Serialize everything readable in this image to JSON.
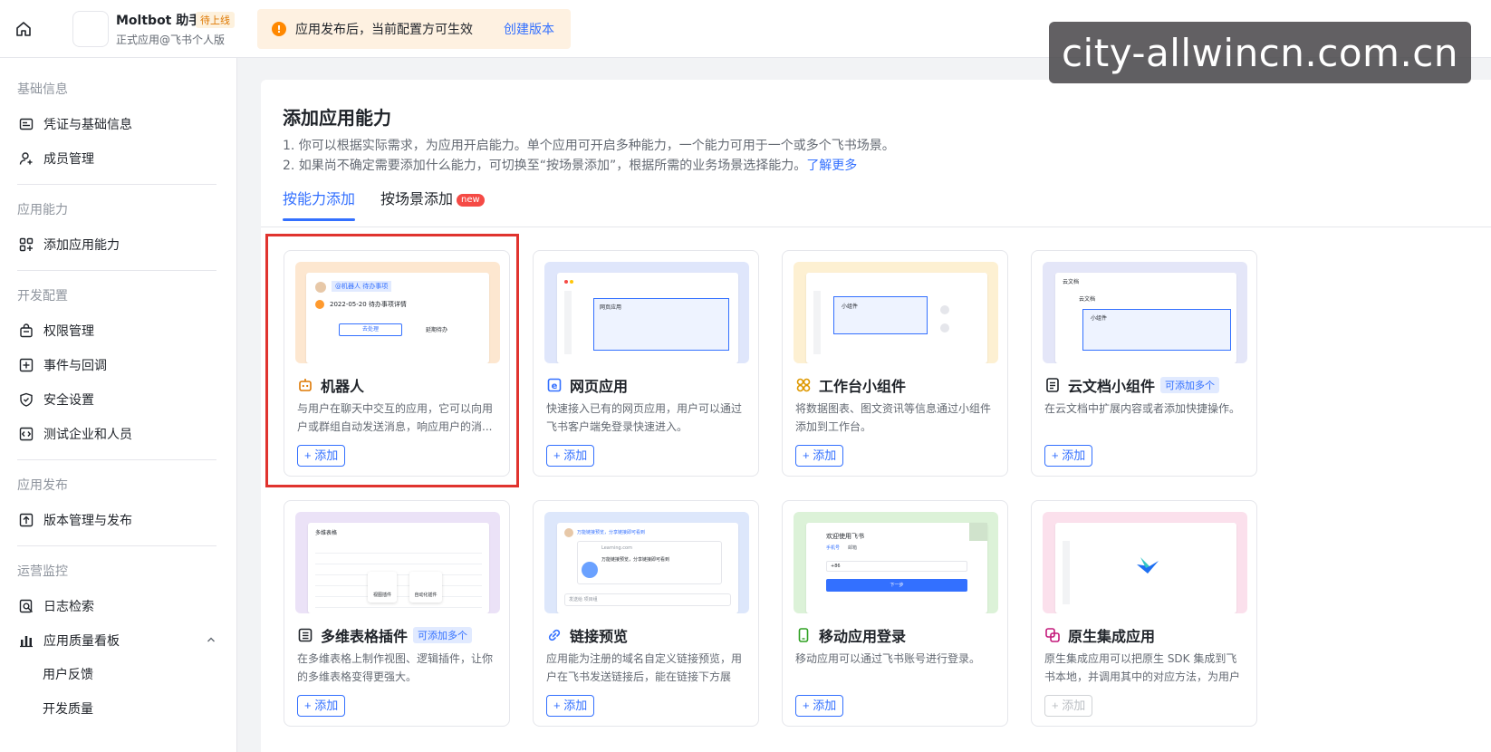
{
  "topbar": {
    "app_name": "Moltbot 助手",
    "app_status": "待上线",
    "app_subtitle": "正式应用@飞书个人版",
    "notice_text": "应用发布后，当前配置方可生效",
    "notice_link": "创建版本",
    "watermark": "city-allwincn.com.cn"
  },
  "sidebar": {
    "sections": [
      {
        "title": "基础信息",
        "items": [
          {
            "label": "凭证与基础信息",
            "icon": "id-card-icon"
          },
          {
            "label": "成员管理",
            "icon": "user-add-icon"
          }
        ]
      },
      {
        "title": "应用能力",
        "items": [
          {
            "label": "添加应用能力",
            "icon": "apps-add-icon"
          }
        ]
      },
      {
        "title": "开发配置",
        "items": [
          {
            "label": "权限管理",
            "icon": "lock-icon"
          },
          {
            "label": "事件与回调",
            "icon": "event-icon"
          },
          {
            "label": "安全设置",
            "icon": "shield-icon"
          },
          {
            "label": "测试企业和人员",
            "icon": "code-icon"
          }
        ]
      },
      {
        "title": "应用发布",
        "items": [
          {
            "label": "版本管理与发布",
            "icon": "upload-icon"
          }
        ]
      },
      {
        "title": "运营监控",
        "items": [
          {
            "label": "日志检索",
            "icon": "log-search-icon"
          },
          {
            "label": "应用质量看板",
            "icon": "bar-chart-icon"
          }
        ]
      }
    ],
    "subitems": [
      "用户反馈",
      "开发质量"
    ]
  },
  "main": {
    "title": "添加应用能力",
    "desc_line1": "1. 你可以根据实际需求，为应用开启能力。单个应用可开启多种能力，一个能力可用于一个或多个飞书场景。",
    "desc_line2": "2. 如果尚不确定需要添加什么能力，可切换至“按场景添加”，根据所需的业务场景选择能力。",
    "desc_link": "了解更多",
    "tabs": [
      {
        "label": "按能力添加",
        "active": true
      },
      {
        "label": "按场景添加",
        "badge": "new"
      }
    ]
  },
  "cards": [
    {
      "title": "机器人",
      "icon": "robot-icon",
      "desc": "与用户在聊天中交互的应用，它可以向用户或群组自动发送消息，响应用户的消...",
      "button": "+ 添加",
      "tag": "",
      "disabled": false,
      "bg": "#fde7d0"
    },
    {
      "title": "网页应用",
      "icon": "web-app-icon",
      "desc": "快速接入已有的网页应用，用户可以通过飞书客户端免登录快速进入。",
      "button": "+ 添加",
      "tag": "",
      "disabled": false,
      "bg": "#dfe6fb"
    },
    {
      "title": "工作台小组件",
      "icon": "widget-icon",
      "desc": "将数据图表、图文资讯等信息通过小组件添加到工作台。",
      "button": "+ 添加",
      "tag": "",
      "disabled": false,
      "bg": "#fdf0d2"
    },
    {
      "title": "云文档小组件",
      "icon": "doc-widget-icon",
      "desc": "在云文档中扩展内容或者添加快捷操作。",
      "button": "+ 添加",
      "tag": "可添加多个",
      "disabled": false,
      "bg": "#e4e6f8"
    },
    {
      "title": "多维表格插件",
      "icon": "table-plugin-icon",
      "desc": "在多维表格上制作视图、逻辑插件，让你的多维表格变得更强大。",
      "button": "+ 添加",
      "tag": "可添加多个",
      "disabled": false,
      "bg": "#ebe2f7"
    },
    {
      "title": "链接预览",
      "icon": "link-icon",
      "desc": "应用能为注册的域名自定义链接预览，用户在飞书发送链接后，能在链接下方展示...",
      "button": "+ 添加",
      "tag": "",
      "disabled": false,
      "bg": "#dde7fb"
    },
    {
      "title": "移动应用登录",
      "icon": "mobile-icon",
      "desc": "移动应用可以通过飞书账号进行登录。",
      "button": "+ 添加",
      "tag": "",
      "disabled": false,
      "bg": "#dcf2d8"
    },
    {
      "title": "原生集成应用",
      "icon": "native-app-icon",
      "desc": "原生集成应用可以把原生 SDK 集成到飞书本地，并调用其中的对应方法，为用户提...",
      "button": "+ 添加",
      "tag": "",
      "disabled": true,
      "bg": "#fbe0ec"
    }
  ],
  "previews": {
    "robot_tag": "@机器人 待办事项",
    "robot_date": "2022-05-20 待办事项详情",
    "robot_btn1": "去处理",
    "robot_btn2": "延期待办",
    "web_tab": "网页应用",
    "widget_label": "小组件",
    "doc_header": "云文档",
    "doc_title": "云文档",
    "doc_widget": "小组件",
    "table_header": "多维表格",
    "table_plugin1": "视图插件",
    "table_plugin2": "自动化插件",
    "link_msg": "万能链接预览，分享链接即可看到",
    "link_url": "Learning.com",
    "link_snippet": "万能链接预览，分享链接即可看到",
    "link_input": "发送给 项目组",
    "login_welcome": "欢迎使用飞书",
    "login_tab1": "手机号",
    "login_tab2": "邮箱",
    "login_code": "+86",
    "login_btn": "下一步"
  },
  "colors": {
    "accent": "#3370ff",
    "highlight": "#e0332e",
    "warning": "#ff8800"
  }
}
